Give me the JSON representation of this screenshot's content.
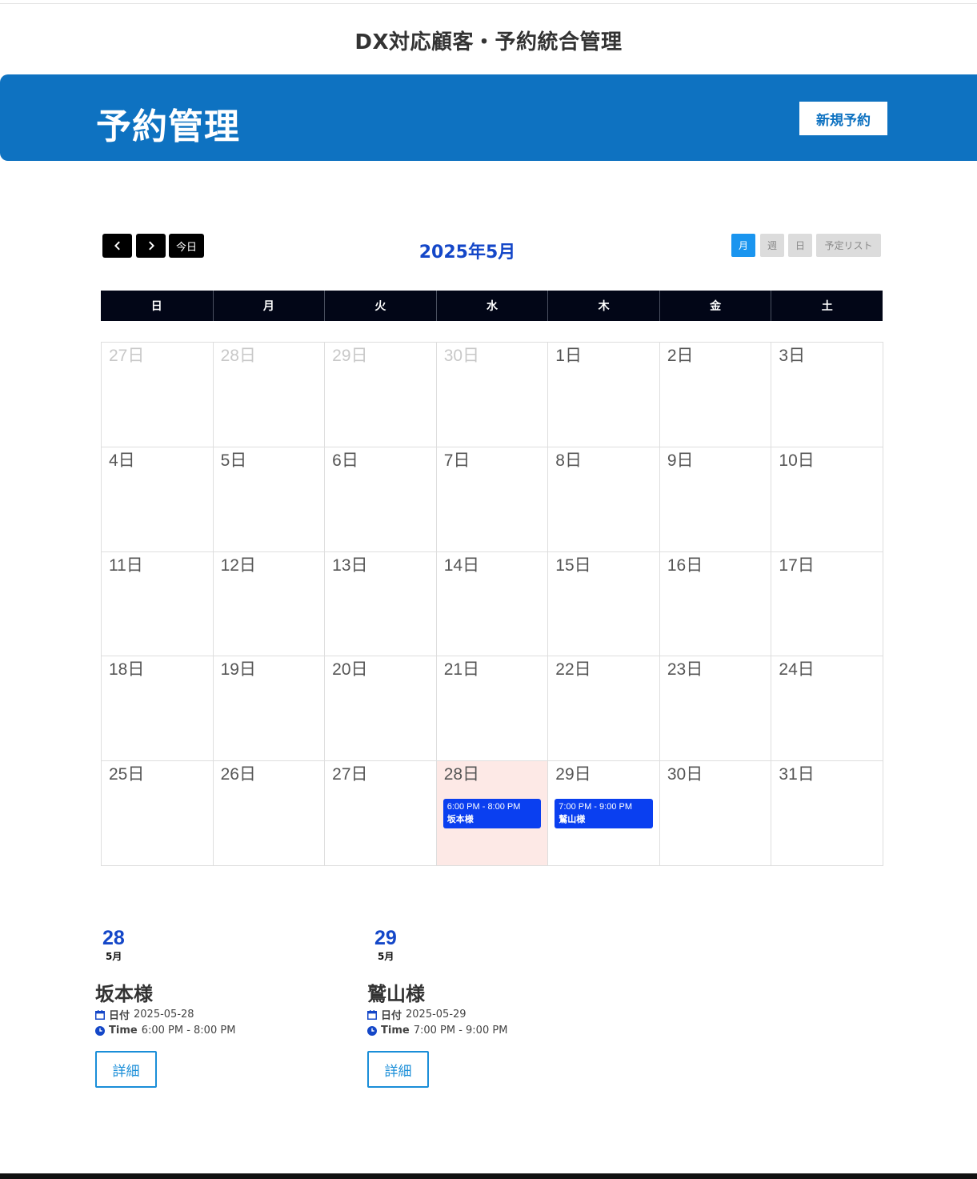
{
  "site": {
    "title": "DX対応顧客・予約統合管理"
  },
  "banner": {
    "title": "予約管理",
    "new_button": "新規予約"
  },
  "calendar": {
    "title": "2025年5月",
    "today_button": "今日",
    "views": {
      "month": "月",
      "week": "週",
      "day": "日",
      "list": "予定リスト"
    },
    "weekdays": [
      "日",
      "月",
      "火",
      "水",
      "木",
      "金",
      "土"
    ],
    "days": [
      "27日",
      "28日",
      "29日",
      "30日",
      "1日",
      "2日",
      "3日",
      "4日",
      "5日",
      "6日",
      "7日",
      "8日",
      "9日",
      "10日",
      "11日",
      "12日",
      "13日",
      "14日",
      "15日",
      "16日",
      "17日",
      "18日",
      "19日",
      "20日",
      "21日",
      "22日",
      "23日",
      "24日",
      "25日",
      "26日",
      "27日",
      "28日",
      "29日",
      "30日",
      "31日"
    ],
    "events": [
      {
        "time": "6:00 PM - 8:00 PM",
        "title": "坂本様"
      },
      {
        "time": "7:00 PM - 9:00 PM",
        "title": "鷲山様"
      }
    ]
  },
  "reservations": [
    {
      "day": "28",
      "month": "5月",
      "name": "坂本様",
      "date_label": "日付",
      "date": "2025-05-28",
      "time_label": "Time",
      "time": "6:00 PM - 8:00 PM",
      "button": "詳細"
    },
    {
      "day": "29",
      "month": "5月",
      "name": "鷲山様",
      "date_label": "日付",
      "date": "2025-05-29",
      "time_label": "Time",
      "time": "7:00 PM - 9:00 PM",
      "button": "詳細"
    }
  ],
  "colors": {
    "primary": "#0e72c1",
    "accent": "#1447c8",
    "event": "#0a3ff0",
    "today_bg": "#fde9e6",
    "header_dark": "#020617"
  }
}
